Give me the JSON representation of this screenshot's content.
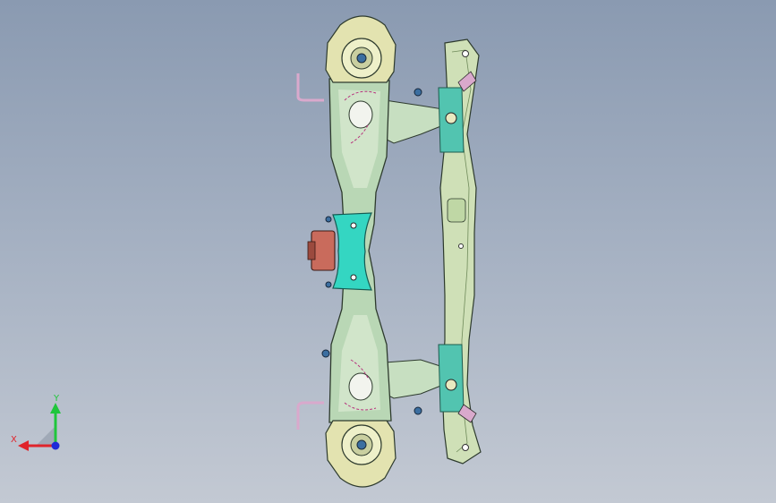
{
  "viewport": {
    "background_top": "#8a9ab1",
    "background_bottom": "#c3c9d3"
  },
  "model": {
    "colors": {
      "frame": "#b9d7b5",
      "frame_light": "#d7e8cf",
      "mount": "#e3e3b0",
      "cyan_part": "#34d6c2",
      "teal_bracket": "#52c4b0",
      "rail": "#cfe0b7",
      "bracket_pink": "#d9a9cc",
      "motor_red": "#c96b5c",
      "edge": "#2d3a2d",
      "accent_pink": "#b7327d"
    }
  },
  "triad": {
    "x_label": "X",
    "y_label": "Y",
    "x_color": "#e0242b",
    "y_color": "#1fc63b",
    "z_color": "#1e2ad8"
  }
}
